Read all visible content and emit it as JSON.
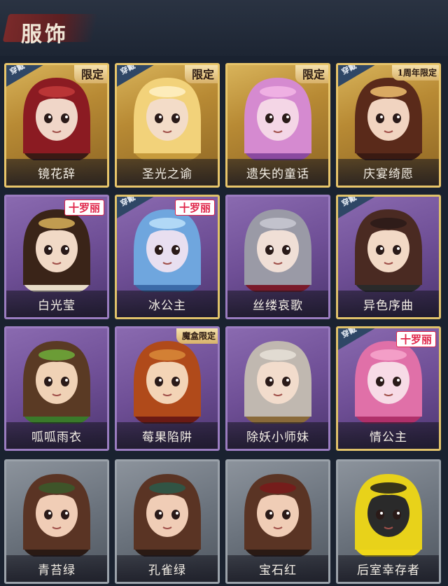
{
  "header": {
    "title": "服饰"
  },
  "labels": {
    "wearing": "穿戴"
  },
  "cards": [
    {
      "name": "镜花辞",
      "rarity": "gold",
      "tag": "限定",
      "wearing": true,
      "palette": [
        "#8b1b22",
        "#c23a3a",
        "#f0d6c8",
        "#3a1a14"
      ]
    },
    {
      "name": "圣光之谕",
      "rarity": "gold",
      "tag": "限定",
      "wearing": true,
      "palette": [
        "#f2d27a",
        "#fff1c6",
        "#f3dcc8",
        "#c79b3c"
      ]
    },
    {
      "name": "遗失的童话",
      "rarity": "gold",
      "tag": "限定",
      "wearing": false,
      "palette": [
        "#d58ad0",
        "#f3b6e6",
        "#f4d6e6",
        "#8a4aa0"
      ]
    },
    {
      "name": "庆宴绮愿",
      "rarity": "gold",
      "tag": "1周年限定",
      "wearing": true,
      "palette": [
        "#5a2a1a",
        "#f0c070",
        "#f1d4c0",
        "#3a1a12"
      ]
    },
    {
      "name": "白光莹",
      "rarity": "purple",
      "tag": "十罗丽",
      "wearing": false,
      "palette": [
        "#3a2418",
        "#d9b25a",
        "#f1d9c6",
        "#e8dcc8"
      ]
    },
    {
      "name": "冰公主",
      "rarity": "purple",
      "tag": "十罗丽",
      "wearing": true,
      "palette": [
        "#6fa6de",
        "#bde0fa",
        "#e8dff0",
        "#3b6aa8"
      ]
    },
    {
      "name": "丝缕哀歌",
      "rarity": "purple",
      "tag": "",
      "wearing": false,
      "palette": [
        "#9a9aa6",
        "#c9c9d2",
        "#f0dfd6",
        "#7a1a2a"
      ]
    },
    {
      "name": "异色序曲",
      "rarity": "purple",
      "tag": "",
      "wearing": true,
      "palette": [
        "#4a2a22",
        "#2a1a18",
        "#f2d9c6",
        "#2a2a2a"
      ]
    },
    {
      "name": "呱呱雨衣",
      "rarity": "purple",
      "tag": "",
      "wearing": false,
      "palette": [
        "#5a3a24",
        "#6fae3a",
        "#f0d2b6",
        "#3a7a2a"
      ]
    },
    {
      "name": "莓果陷阱",
      "rarity": "purple",
      "tag": "魔盒限定",
      "wearing": false,
      "palette": [
        "#b04a1a",
        "#d98a3a",
        "#f3d4b6",
        "#6a1a14"
      ]
    },
    {
      "name": "除妖小师妹",
      "rarity": "purple",
      "tag": "",
      "wearing": false,
      "palette": [
        "#c0b8b0",
        "#e6e0d8",
        "#f2dccc",
        "#8a6a3a"
      ]
    },
    {
      "name": "情公主",
      "rarity": "purple",
      "tag": "十罗丽",
      "wearing": true,
      "palette": [
        "#e070a8",
        "#f6a6cc",
        "#f7dbe6",
        "#b0306a"
      ]
    },
    {
      "name": "青苔绿",
      "rarity": "grey",
      "tag": "",
      "wearing": false,
      "palette": [
        "#5a3424",
        "#3a5a2a",
        "#f0cdb6",
        "#2a1a14"
      ]
    },
    {
      "name": "孔雀绿",
      "rarity": "grey",
      "tag": "",
      "wearing": false,
      "palette": [
        "#5a3424",
        "#2a5a4a",
        "#f0cdb6",
        "#2a1a14"
      ]
    },
    {
      "name": "宝石红",
      "rarity": "grey",
      "tag": "",
      "wearing": false,
      "palette": [
        "#5a3424",
        "#7a1a1a",
        "#f0cdb6",
        "#2a1a14"
      ]
    },
    {
      "name": "后室幸存者",
      "rarity": "grey",
      "tag": "",
      "wearing": false,
      "palette": [
        "#e8d21a",
        "#1a1a1a",
        "#2a2a2a",
        "#f0d818"
      ]
    }
  ]
}
